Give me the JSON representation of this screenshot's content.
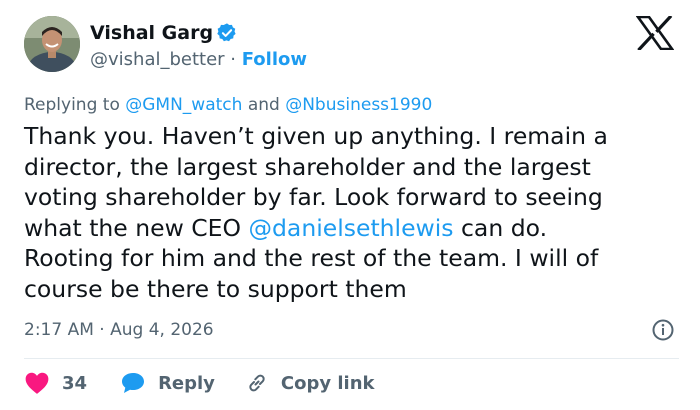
{
  "author": {
    "name": "Vishal Garg",
    "handle": "@vishal_better",
    "separator": " · ",
    "follow_label": "Follow"
  },
  "reply_context": {
    "prefix": "Replying to ",
    "mention1": "@GMN_watch",
    "conjunction": " and ",
    "mention2": "@Nbusiness1990"
  },
  "tweet": {
    "text_part1": "Thank you. Haven’t given up anything. I remain a\ndirector, the largest shareholder and the largest\nvoting shareholder by far. Look forward to seeing\nwhat the new CEO ",
    "mention": "@danielsethlewis",
    "text_part2": " can do.\nRooting for him and the rest of the team. I will of\ncourse be there to support them"
  },
  "meta": {
    "time": "2:17 AM",
    "separator": " · ",
    "date": "Aug 4, 2026"
  },
  "actions": {
    "like_count": "34",
    "reply_label": "Reply",
    "copy_link_label": "Copy link"
  },
  "icons": {
    "verified": "verified-badge-icon",
    "x_logo": "x-logo-icon",
    "info": "info-icon",
    "heart": "heart-icon",
    "reply": "reply-bubble-icon",
    "link": "link-icon"
  },
  "colors": {
    "accent": "#1d9bf0",
    "like": "#f91880",
    "text": "#0f1419",
    "muted": "#536471"
  }
}
